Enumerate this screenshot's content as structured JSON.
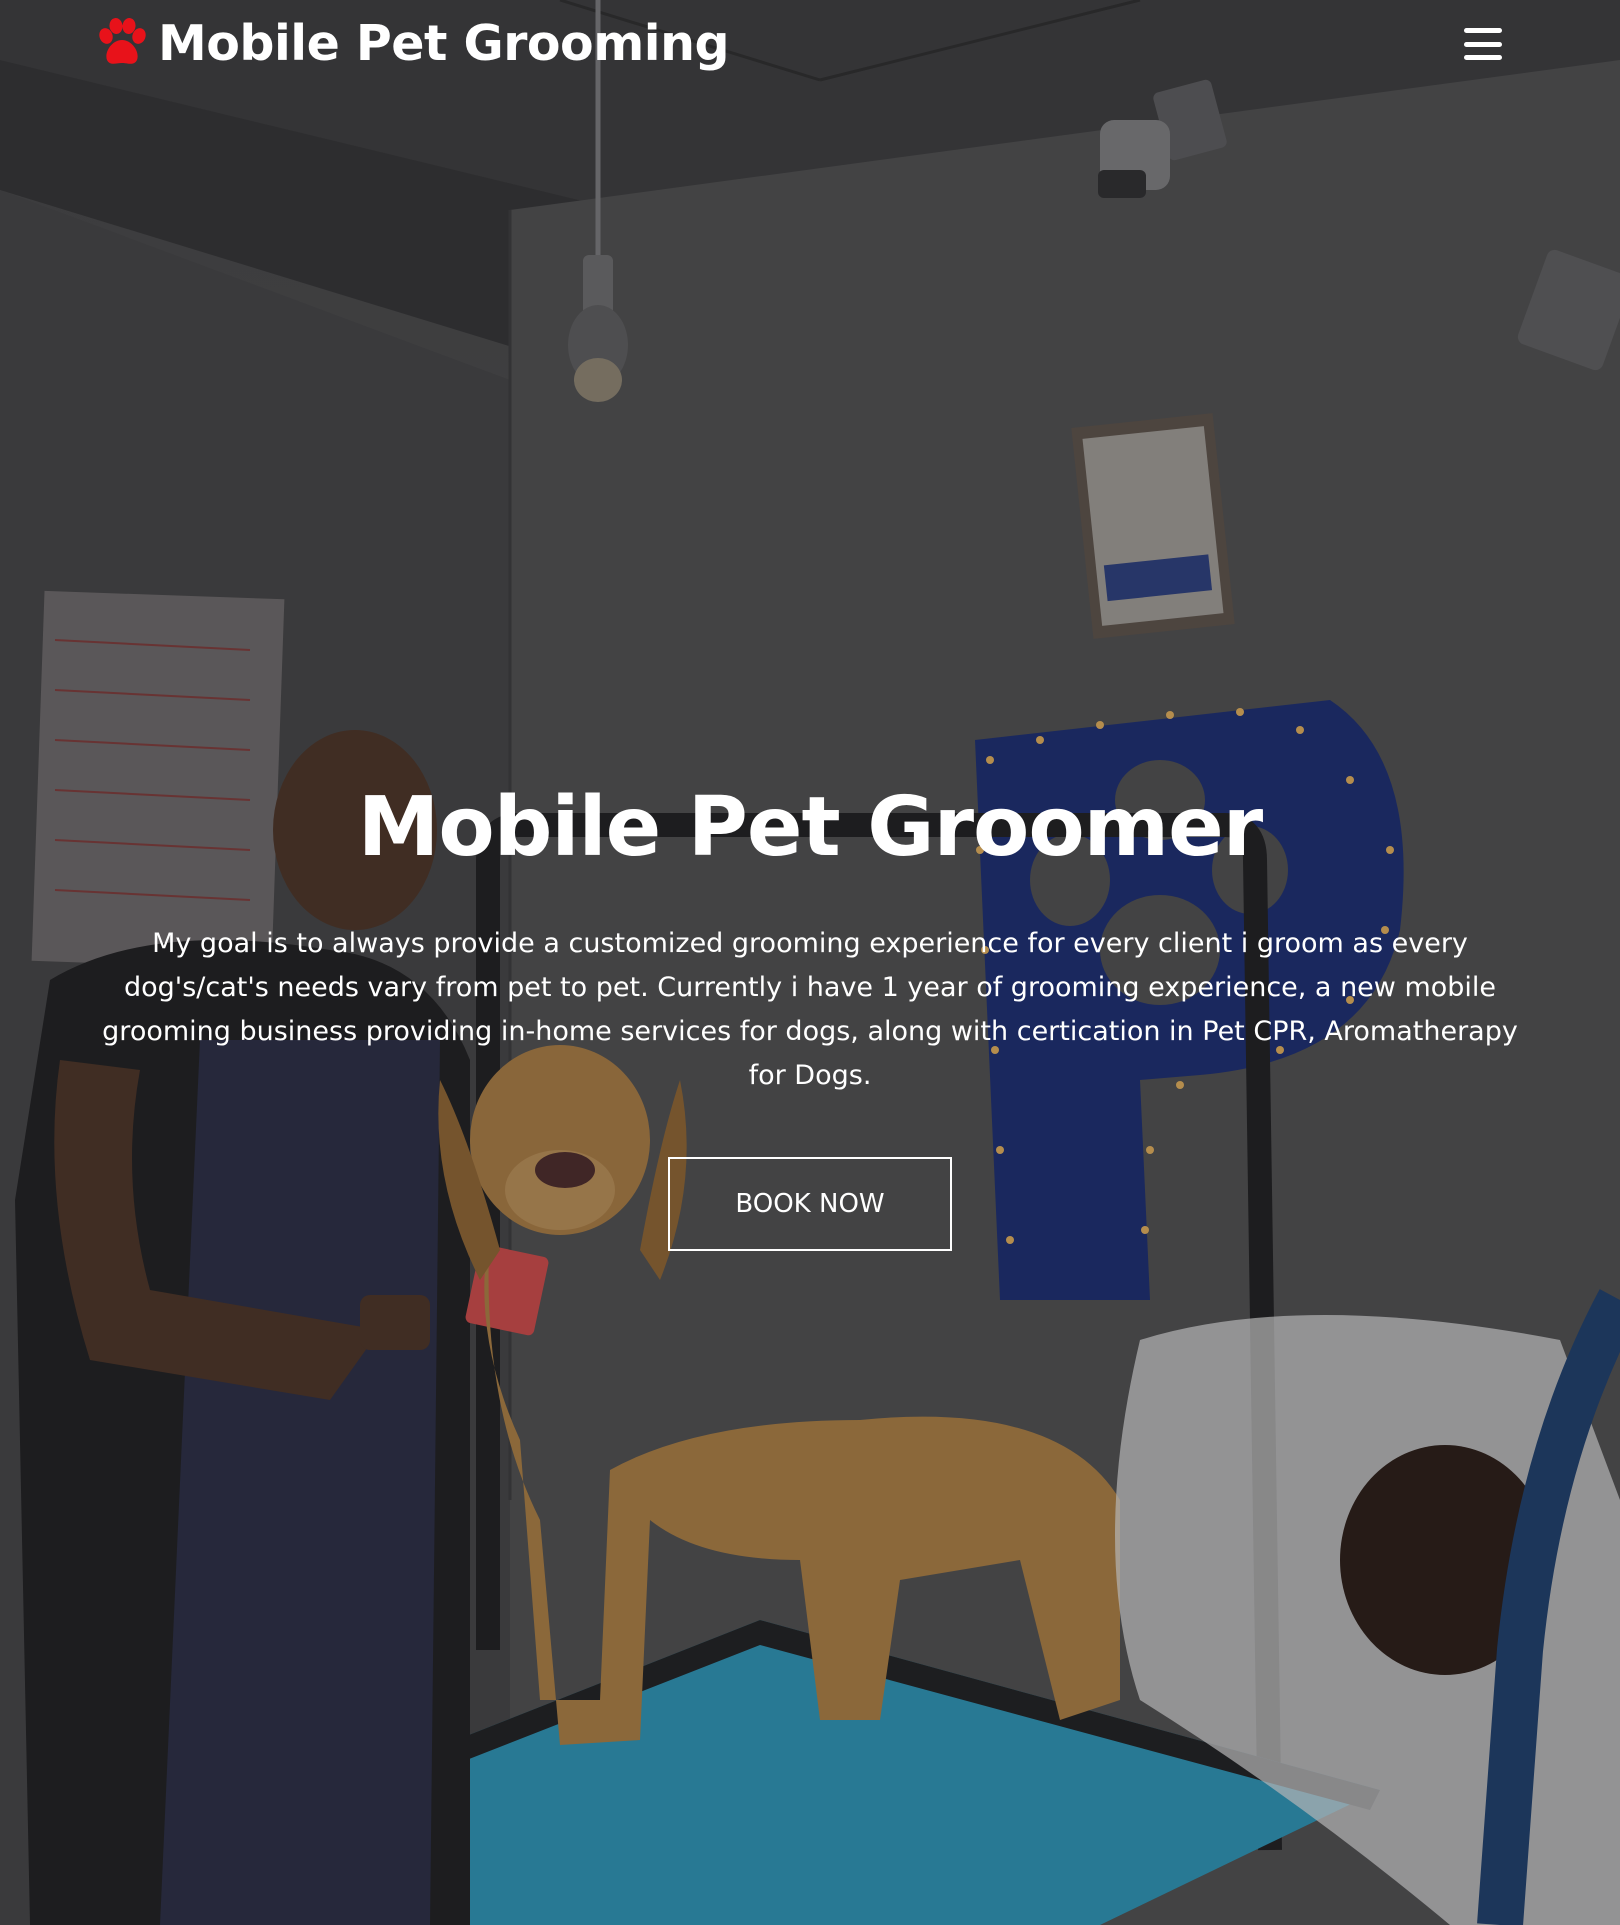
{
  "nav": {
    "brand_icon": "paw-icon",
    "brand_text": "Mobile Pet Grooming",
    "brand_icon_color": "#e8121a",
    "menu_icon": "hamburger-menu-icon"
  },
  "hero": {
    "title": "Mobile Pet Groomer",
    "description": "My goal is to always provide a customized grooming experience for every client i groom as every dog's/cat's needs vary from pet to pet. Currently i have 1 year of grooming experience, a new mobile grooming business providing in-home services for dogs, along with certication in Pet CPR, Aromatherapy for Dogs.",
    "cta_label": "BOOK NOW",
    "background": "photo of a groomer brushing a golden retriever on a blue grooming table"
  },
  "colors": {
    "accent": "#e8121a",
    "text": "#ffffff"
  }
}
